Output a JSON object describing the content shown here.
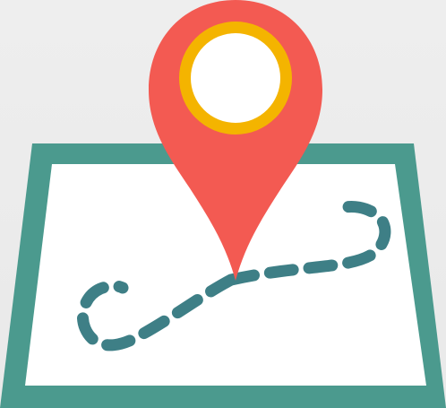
{
  "icon": {
    "name": "map-location-pin-icon",
    "colors": {
      "background": "#ececec",
      "map_frame": "#4b9a8e",
      "map_paper": "#ffffff",
      "route": "#3e7f86",
      "pin": "#f35a52",
      "pin_ring": "#f4b400",
      "pin_center": "#ffffff"
    }
  }
}
